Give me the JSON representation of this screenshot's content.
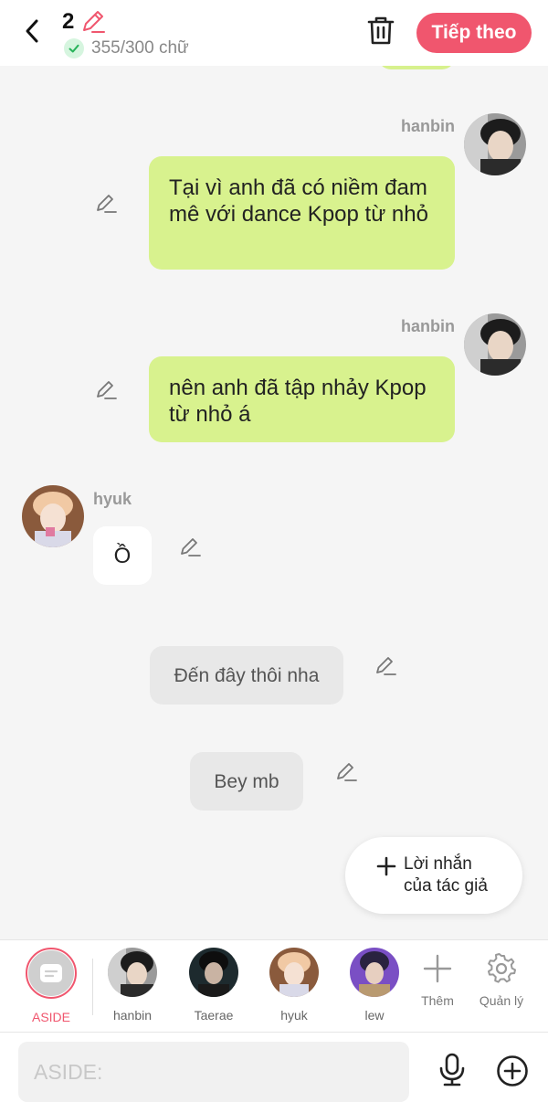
{
  "header": {
    "chapter_number": "2",
    "word_count": "355/300 chữ",
    "next_label": "Tiếp theo"
  },
  "messages": [
    {
      "sender": "hanbin",
      "side": "right",
      "style": "green",
      "text": "Tại vì anh đã có niềm đam mê với dance Kpop từ nhỏ"
    },
    {
      "sender": "hanbin",
      "side": "right",
      "style": "green",
      "text": "nên anh đã tập nhảy Kpop từ nhỏ á"
    },
    {
      "sender": "hyuk",
      "side": "left",
      "style": "white",
      "text": "Ồ"
    },
    {
      "sender": "ASIDE",
      "side": "center",
      "style": "gray",
      "text": "Đến đây thôi nha"
    },
    {
      "sender": "ASIDE",
      "side": "center",
      "style": "gray",
      "text": "Bey mb"
    }
  ],
  "author_note": {
    "line1": "Lời nhắn",
    "line2": "của tác giả"
  },
  "characters": [
    {
      "name": "ASIDE",
      "active": true
    },
    {
      "name": "hanbin"
    },
    {
      "name": "Taerae"
    },
    {
      "name": "hyuk"
    },
    {
      "name": "lew"
    }
  ],
  "tools": {
    "add_label": "Thêm",
    "manage_label": "Quản lý"
  },
  "input": {
    "placeholder": "ASIDE:",
    "value": ""
  },
  "colors": {
    "accent": "#f0566e",
    "bubble_green": "#d8f28e",
    "bubble_gray": "#e8e8e8",
    "background": "#f5f5f5"
  }
}
